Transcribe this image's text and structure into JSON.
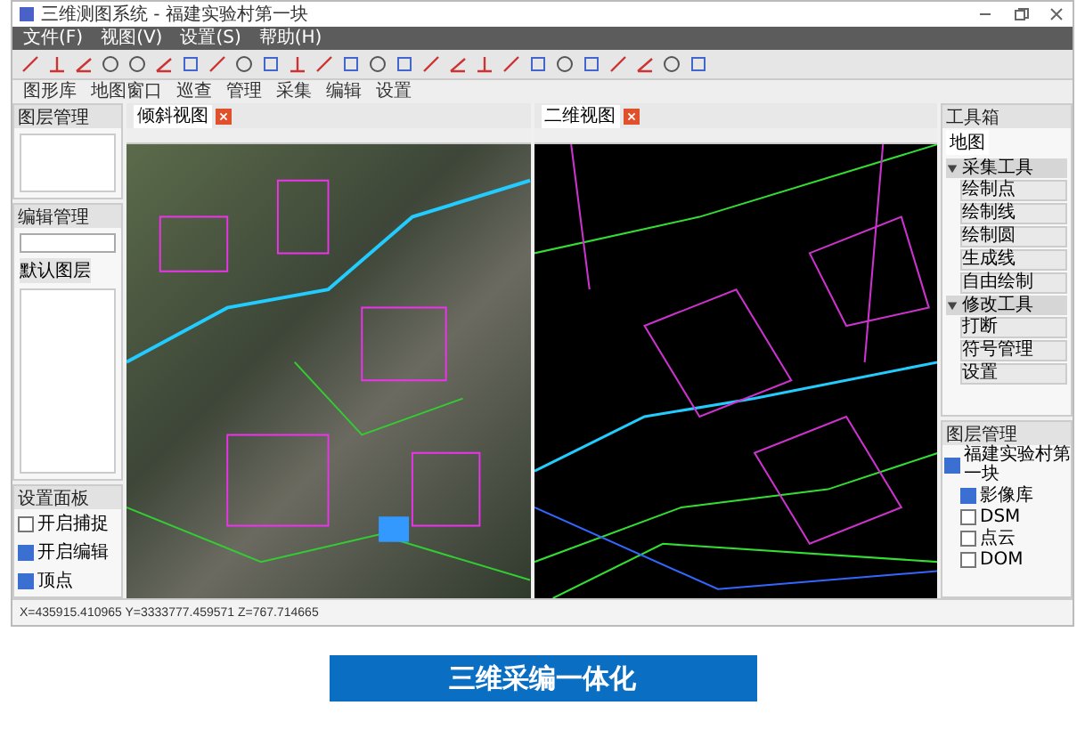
{
  "window": {
    "title": "三维测图系统 - 福建实验村第一块"
  },
  "menu": [
    "文件(F)",
    "视图(V)",
    "设置(S)",
    "帮助(H)"
  ],
  "toolbar2": [
    "图形库",
    "地图窗口",
    "巡查",
    "管理",
    "采集",
    "编辑",
    "设置"
  ],
  "left_panels": [
    {
      "title": "图层管理",
      "kind": "grid"
    },
    {
      "title": "编辑管理",
      "kind": "list",
      "label": "默认图层"
    },
    {
      "title": "设置面板",
      "kind": "checks",
      "items": [
        {
          "label": "开启捕捉",
          "checked": false
        },
        {
          "label": "开启编辑",
          "checked": true
        },
        {
          "label": "顶点",
          "checked": true
        }
      ]
    }
  ],
  "views": [
    {
      "title": "倾斜视图",
      "kind": "photo"
    },
    {
      "title": "二维视图",
      "kind": "cad"
    }
  ],
  "toolbox": {
    "title": "工具箱",
    "tab": "地图",
    "groups": [
      {
        "title": "采集工具",
        "expanded": true,
        "items": [
          "绘制点",
          "绘制线",
          "绘制圆",
          "生成线",
          "自由绘制"
        ]
      },
      {
        "title": "修改工具",
        "expanded": true,
        "items": [
          "打断",
          "符号管理",
          "设置"
        ]
      }
    ]
  },
  "tree": {
    "title": "图层管理",
    "children": [
      {
        "label": "福建实验村第一块",
        "checked": true,
        "children": [
          {
            "label": "影像库",
            "checked": true
          },
          {
            "label": "DSM",
            "checked": false
          },
          {
            "label": "点云",
            "checked": false
          },
          {
            "label": "DOM",
            "checked": false
          }
        ]
      }
    ]
  },
  "status": {
    "coords": "X=435915.410965  Y=3333777.459571  Z=767.714665"
  },
  "caption": "三维采编一体化"
}
